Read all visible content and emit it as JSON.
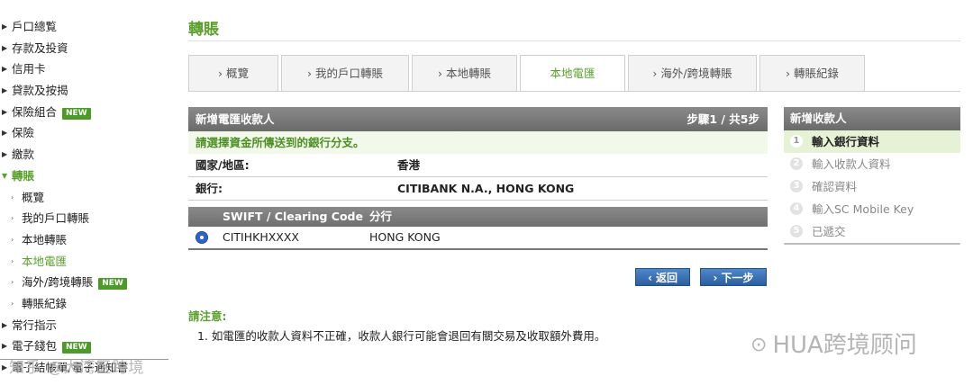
{
  "sidebar": {
    "items": [
      {
        "label": "戶口總覧"
      },
      {
        "label": "存款及投資"
      },
      {
        "label": "信用卡"
      },
      {
        "label": "貸款及按揭"
      },
      {
        "label": "保險組合",
        "badge": "NEW"
      },
      {
        "label": "保險"
      },
      {
        "label": "繳款"
      },
      {
        "label": "轉賬"
      },
      {
        "label": "概覽"
      },
      {
        "label": "我的戶口轉賬"
      },
      {
        "label": "本地轉賬"
      },
      {
        "label": "本地電匯"
      },
      {
        "label": "海外/跨境轉賬",
        "badge": "NEW"
      },
      {
        "label": "轉賬紀錄"
      },
      {
        "label": "常行指示"
      },
      {
        "label": "電子錢包",
        "badge": "NEW"
      },
      {
        "label": "電子結帳單/電子通知書"
      }
    ],
    "watermark": "知乎 @大湾区跨境"
  },
  "page_title": "轉賬",
  "tabs": [
    "› 概覽",
    "› 我的戶口轉賬",
    "› 本地轉賬",
    "本地電匯",
    "› 海外/跨境轉賬",
    "› 轉賬紀錄"
  ],
  "panel": {
    "title": "新增電匯收款人",
    "step": "步驟1 / 共5步",
    "instruction": "請選擇資金所傳送到的銀行分支。",
    "country_label": "國家/地區:",
    "country_value": "香港",
    "bank_label": "銀行:",
    "bank_value": "CITIBANK N.A., HONG KONG",
    "table": {
      "headers": [
        "SWIFT / Clearing Code",
        "分行"
      ],
      "rows": [
        [
          "CITIHKHXXXX",
          "HONG KONG"
        ]
      ]
    }
  },
  "buttons": {
    "back": "‹ 返回",
    "next": "› 下一步"
  },
  "notice": {
    "title": "請注意:",
    "text": "1.  如電匯的收款人資料不正確，收款人銀行可能會退回有關交易及收取額外費用。"
  },
  "steps": {
    "title": "新增收款人",
    "items": [
      {
        "num": "1",
        "label": "輸入銀行資料"
      },
      {
        "num": "2",
        "label": "輸入收款人資料"
      },
      {
        "num": "3",
        "label": "確認資料"
      },
      {
        "num": "4",
        "label": "輸入SC Mobile Key"
      },
      {
        "num": "5",
        "label": "已遞交"
      }
    ]
  },
  "watermark_right": "HUA跨境顾问",
  "colors": {
    "accent_green": "#5aa02c",
    "button_blue": "#2c5f9e",
    "header_gray": "#777777"
  }
}
